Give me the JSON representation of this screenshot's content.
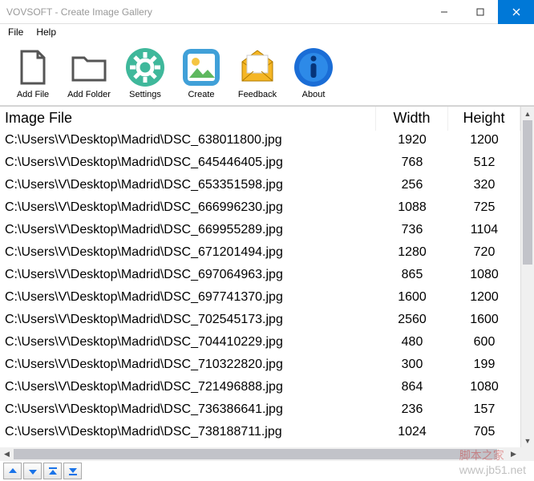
{
  "window": {
    "title": "VOVSOFT - Create Image Gallery"
  },
  "menu": {
    "file": "File",
    "help": "Help"
  },
  "toolbar": {
    "addfile": "Add File",
    "addfolder": "Add Folder",
    "settings": "Settings",
    "create": "Create",
    "feedback": "Feedback",
    "about": "About"
  },
  "columns": {
    "path": "Image File",
    "width": "Width",
    "height": "Height"
  },
  "rows": [
    {
      "path": "C:\\Users\\V\\Desktop\\Madrid\\DSC_638011800.jpg",
      "w": "1920",
      "h": "1200"
    },
    {
      "path": "C:\\Users\\V\\Desktop\\Madrid\\DSC_645446405.jpg",
      "w": "768",
      "h": "512"
    },
    {
      "path": "C:\\Users\\V\\Desktop\\Madrid\\DSC_653351598.jpg",
      "w": "256",
      "h": "320"
    },
    {
      "path": "C:\\Users\\V\\Desktop\\Madrid\\DSC_666996230.jpg",
      "w": "1088",
      "h": "725"
    },
    {
      "path": "C:\\Users\\V\\Desktop\\Madrid\\DSC_669955289.jpg",
      "w": "736",
      "h": "1104"
    },
    {
      "path": "C:\\Users\\V\\Desktop\\Madrid\\DSC_671201494.jpg",
      "w": "1280",
      "h": "720"
    },
    {
      "path": "C:\\Users\\V\\Desktop\\Madrid\\DSC_697064963.jpg",
      "w": "865",
      "h": "1080"
    },
    {
      "path": "C:\\Users\\V\\Desktop\\Madrid\\DSC_697741370.jpg",
      "w": "1600",
      "h": "1200"
    },
    {
      "path": "C:\\Users\\V\\Desktop\\Madrid\\DSC_702545173.jpg",
      "w": "2560",
      "h": "1600"
    },
    {
      "path": "C:\\Users\\V\\Desktop\\Madrid\\DSC_704410229.jpg",
      "w": "480",
      "h": "600"
    },
    {
      "path": "C:\\Users\\V\\Desktop\\Madrid\\DSC_710322820.jpg",
      "w": "300",
      "h": "199"
    },
    {
      "path": "C:\\Users\\V\\Desktop\\Madrid\\DSC_721496888.jpg",
      "w": "864",
      "h": "1080"
    },
    {
      "path": "C:\\Users\\V\\Desktop\\Madrid\\DSC_736386641.jpg",
      "w": "236",
      "h": "157"
    },
    {
      "path": "C:\\Users\\V\\Desktop\\Madrid\\DSC_738188711.jpg",
      "w": "1024",
      "h": "705"
    }
  ],
  "watermark": {
    "url": "www.jb51.net",
    "cn": "脚本之家"
  }
}
